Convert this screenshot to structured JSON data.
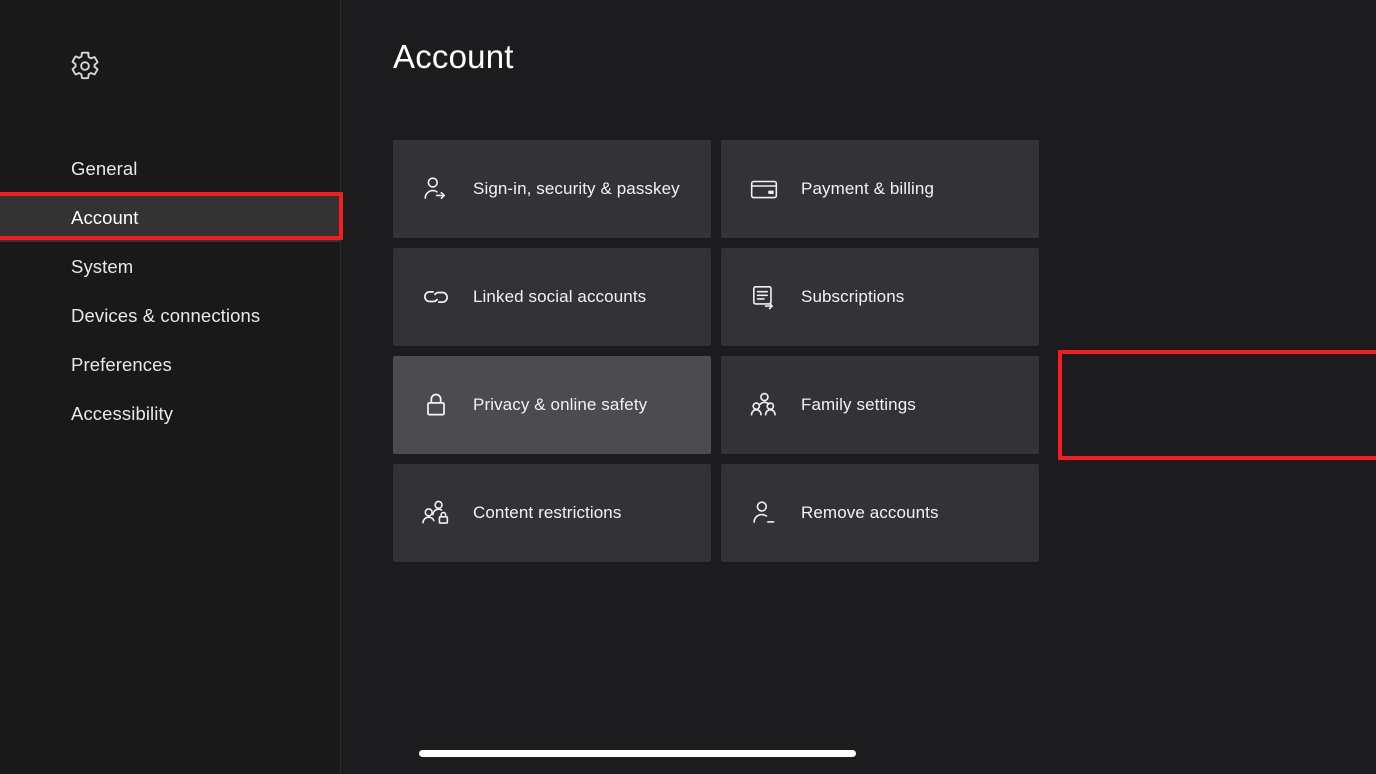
{
  "app": {
    "title": "Account",
    "settings_icon": "gear-icon"
  },
  "sidebar": {
    "items": [
      {
        "label": "General",
        "icon": "none",
        "active": false
      },
      {
        "label": "Account",
        "icon": "none",
        "active": true
      },
      {
        "label": "System",
        "icon": "none",
        "active": false
      },
      {
        "label": "Devices & connections",
        "icon": "none",
        "active": false
      },
      {
        "label": "Preferences",
        "icon": "none",
        "active": false
      },
      {
        "label": "Accessibility",
        "icon": "none",
        "active": false
      }
    ]
  },
  "main": {
    "tiles": [
      {
        "label": "Sign-in, security & passkey",
        "icon": "person-arrow-icon",
        "state": "normal"
      },
      {
        "label": "Payment & billing",
        "icon": "credit-card-icon",
        "state": "normal"
      },
      {
        "label": "Linked social accounts",
        "icon": "link-chain-icon",
        "state": "normal"
      },
      {
        "label": "Subscriptions",
        "icon": "document-arrow-icon",
        "state": "normal"
      },
      {
        "label": "Privacy & online safety",
        "icon": "lock-icon",
        "state": "focused"
      },
      {
        "label": "Family settings",
        "icon": "family-people-icon",
        "state": "normal"
      },
      {
        "label": "Content restrictions",
        "icon": "people-lock-icon",
        "state": "normal"
      },
      {
        "label": "Remove accounts",
        "icon": "person-minus-icon",
        "state": "normal"
      }
    ]
  },
  "scrollbar": {
    "name": "horizontal-scrollbar",
    "position_percent": 0
  },
  "annotations": {
    "color": "#f61c20",
    "boxes": [
      {
        "target": "sidebar-item-account",
        "name": "annotation-box-account"
      },
      {
        "target": "tile-family-settings",
        "name": "annotation-box-family-settings"
      }
    ]
  },
  "colors": {
    "background": "#1c1c1e",
    "sidebar_background": "#191919",
    "tile_background": "#333335",
    "tile_focused_background": "#4c4c4e",
    "nav_active_background": "#333336",
    "text": "#ffffff",
    "annotation_red": "#f61c20",
    "scrollbar_thumb": "#ffffff"
  }
}
